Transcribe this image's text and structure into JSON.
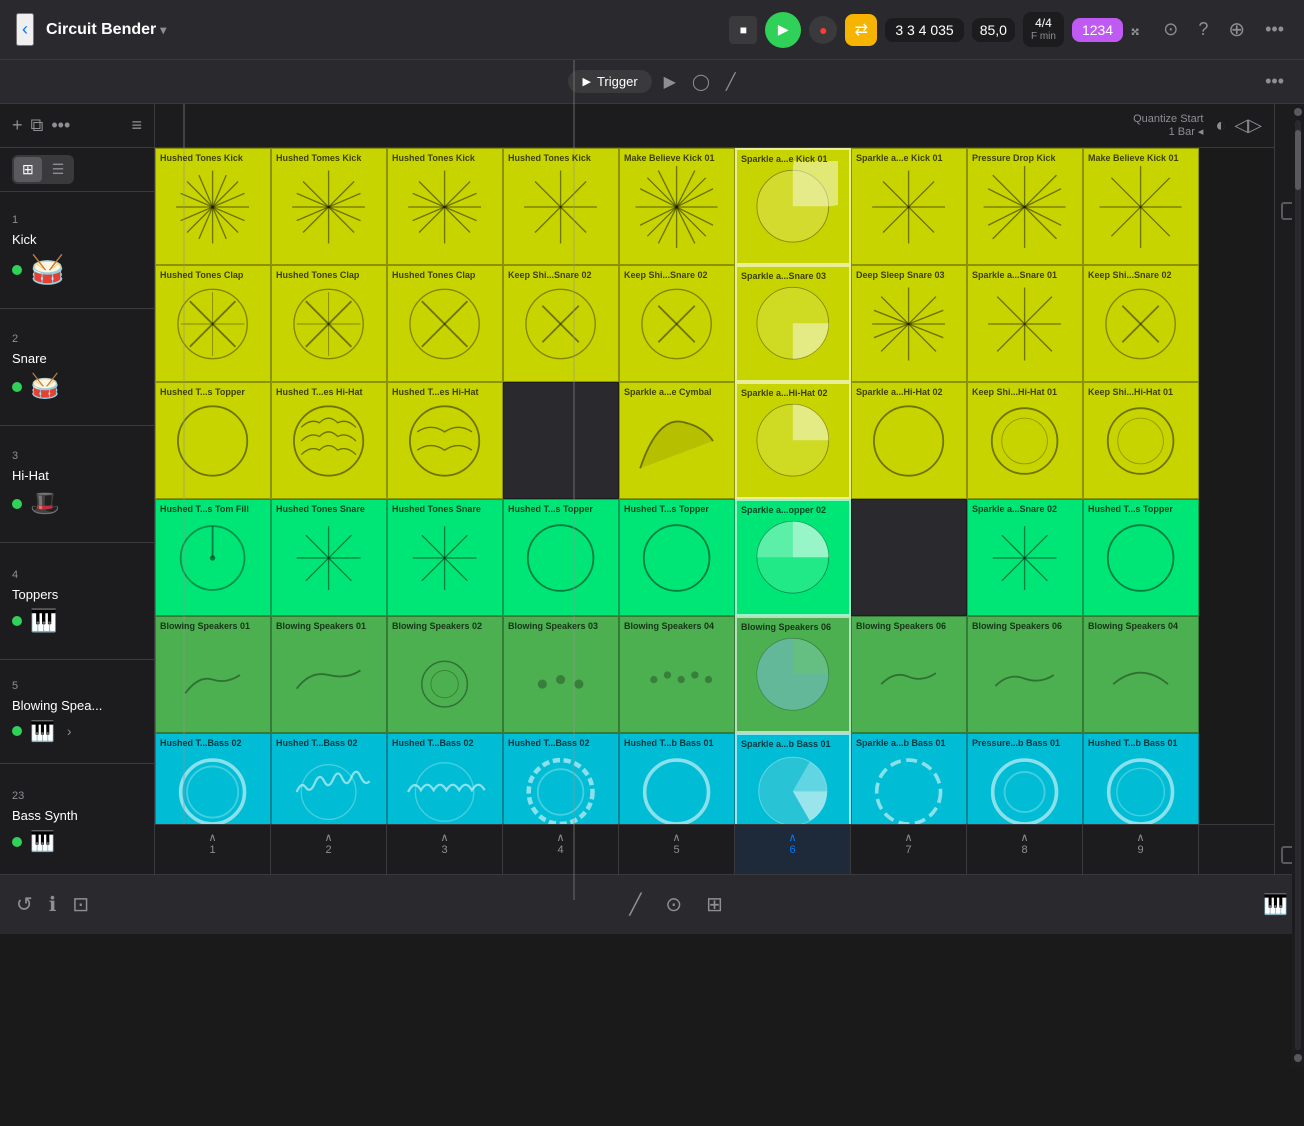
{
  "header": {
    "back": "‹",
    "project_name": "Circuit Bender",
    "chevron": "▾",
    "stop_icon": "■",
    "play_icon": "▶",
    "record_icon": "●",
    "loop_icon": "⇄",
    "position": "3  3  4  035",
    "tempo": "85,0",
    "time_sig_top": "4/4",
    "time_sig_bottom": "F min",
    "key": "1234",
    "metronome_icon": "𝄪",
    "settings_icon": "⊙",
    "help_icon": "?",
    "add_icon": "⊕",
    "more_icon": "•••"
  },
  "second_bar": {
    "trigger_label": "Trigger",
    "trigger_play_icon": "▶",
    "loop_icon": "◯",
    "edit_icon": "╱"
  },
  "sidebar_header": {
    "add_label": "+",
    "duplicate_icon": "⧉",
    "more_icon": "•••",
    "arrange_icon": "≡↕",
    "grid_icon": "⊞",
    "list_icon": "☰"
  },
  "quantize": {
    "label": "Quantize Start",
    "value": "1 Bar ◂"
  },
  "tracks": [
    {
      "num": "1",
      "name": "Kick",
      "dot_color": "#30d158",
      "icon": "🥁"
    },
    {
      "num": "2",
      "name": "Snare",
      "dot_color": "#30d158",
      "icon": "🥁"
    },
    {
      "num": "3",
      "name": "Hi-Hat",
      "dot_color": "#30d158",
      "icon": "🎩"
    },
    {
      "num": "4",
      "name": "Toppers",
      "dot_color": "#30d158",
      "icon": "🎹"
    },
    {
      "num": "5",
      "name": "Blowing Spea...",
      "dot_color": "#30d158",
      "icon": "🎹"
    },
    {
      "num": "23",
      "name": "Bass Synth",
      "dot_color": "#30d158",
      "icon": "🎹"
    }
  ],
  "columns": [
    {
      "num": "1",
      "active": false
    },
    {
      "num": "2",
      "active": false
    },
    {
      "num": "3",
      "active": false
    },
    {
      "num": "4",
      "active": false
    },
    {
      "num": "5",
      "active": false
    },
    {
      "num": "6",
      "active": true
    },
    {
      "num": "7",
      "active": false
    },
    {
      "num": "8",
      "active": false
    },
    {
      "num": "9",
      "active": false
    }
  ],
  "cells": {
    "row0": [
      {
        "label": "Hushed Tones Kick",
        "color": "yellow-green",
        "type": "burst"
      },
      {
        "label": "Hushed Tomes Kick",
        "color": "yellow-green",
        "type": "burst"
      },
      {
        "label": "Hushed Tones Kick",
        "color": "yellow-green",
        "type": "burst"
      },
      {
        "label": "Hushed Tones Kick",
        "color": "yellow-green",
        "type": "burst"
      },
      {
        "label": "Make Believe Kick 01",
        "color": "yellow-green",
        "type": "burst2"
      },
      {
        "label": "Sparkle a...e Kick 01",
        "color": "yellow-green",
        "type": "pie"
      },
      {
        "label": "Sparkle a...e Kick 01",
        "color": "yellow-green",
        "type": "burst"
      },
      {
        "label": "Pressure Drop Kick",
        "color": "yellow-green",
        "type": "burst"
      },
      {
        "label": "Make Believe Kick 01",
        "color": "yellow-green",
        "type": "burst"
      }
    ],
    "row1": [
      {
        "label": "Hushed Tones Clap",
        "color": "yellow-green",
        "type": "x"
      },
      {
        "label": "Hushed Tones Clap",
        "color": "yellow-green",
        "type": "x"
      },
      {
        "label": "Hushed Tones Clap",
        "color": "yellow-green",
        "type": "x"
      },
      {
        "label": "Keep Shi...Snare 02",
        "color": "yellow-green",
        "type": "circle-x"
      },
      {
        "label": "Keep Shi...Snare 02",
        "color": "yellow-green",
        "type": "circle-x"
      },
      {
        "label": "Sparkle a...Snare 03",
        "color": "yellow-green",
        "type": "pie"
      },
      {
        "label": "Deep Sleep Snare 03",
        "color": "yellow-green",
        "type": "star"
      },
      {
        "label": "Sparkle a...Snare 01",
        "color": "yellow-green",
        "type": "star"
      },
      {
        "label": "Keep Shi...Snare 02",
        "color": "yellow-green",
        "type": "circle-x"
      }
    ],
    "row2": [
      {
        "label": "Hushed T...s Topper",
        "color": "yellow-green",
        "type": "circle"
      },
      {
        "label": "Hushed T...es Hi-Hat",
        "color": "yellow-green",
        "type": "circle-wave"
      },
      {
        "label": "Hushed T...es Hi-Hat",
        "color": "yellow-green",
        "type": "circle-wave"
      },
      {
        "label": "",
        "color": "empty",
        "type": "empty"
      },
      {
        "label": "Sparkle a...e Cymbal",
        "color": "yellow-green",
        "type": "horn"
      },
      {
        "label": "Sparkle a...Hi-Hat 02",
        "color": "yellow-green",
        "type": "pie"
      },
      {
        "label": "Sparkle a...Hi-Hat 02",
        "color": "yellow-green",
        "type": "circle"
      },
      {
        "label": "Keep Shi...Hi-Hat 01",
        "color": "yellow-green",
        "type": "circle"
      },
      {
        "label": "Keep Shi...Hi-Hat 01",
        "color": "yellow-green",
        "type": "circle"
      }
    ],
    "row3": [
      {
        "label": "Hushed T...s Tom Fill",
        "color": "bright-green",
        "type": "dial"
      },
      {
        "label": "Hushed Tones Snare",
        "color": "bright-green",
        "type": "burst-sm"
      },
      {
        "label": "Hushed Tones Snare",
        "color": "bright-green",
        "type": "burst-sm"
      },
      {
        "label": "Hushed T...s Topper",
        "color": "bright-green",
        "type": "circle"
      },
      {
        "label": "Hushed T...s Topper",
        "color": "bright-green",
        "type": "circle"
      },
      {
        "label": "Sparkle a...opper 02",
        "color": "bright-green",
        "type": "pie"
      },
      {
        "label": "",
        "color": "empty",
        "type": "empty"
      },
      {
        "label": "Sparkle a...Snare 02",
        "color": "bright-green",
        "type": "burst-sm"
      },
      {
        "label": "Hushed T...s Topper",
        "color": "bright-green",
        "type": "circle"
      }
    ],
    "row4": [
      {
        "label": "Blowing Speakers 01",
        "color": "mid-green",
        "type": "arc"
      },
      {
        "label": "Blowing Speakers 01",
        "color": "mid-green",
        "type": "arc"
      },
      {
        "label": "Blowing Speakers 02",
        "color": "mid-green",
        "type": "arc"
      },
      {
        "label": "Blowing Speakers 03",
        "color": "mid-green",
        "type": "dots"
      },
      {
        "label": "Blowing Speakers 04",
        "color": "mid-green",
        "type": "dots"
      },
      {
        "label": "Blowing Speakers 06",
        "color": "mid-green",
        "type": "pie-lg"
      },
      {
        "label": "Blowing Speakers 06",
        "color": "mid-green",
        "type": "arc"
      },
      {
        "label": "Blowing Speakers 06",
        "color": "mid-green",
        "type": "arc"
      },
      {
        "label": "Blowing Speakers 04",
        "color": "mid-green",
        "type": "arc"
      }
    ],
    "row5": [
      {
        "label": "Hushed T...Bass 02",
        "color": "teal",
        "type": "ring"
      },
      {
        "label": "Hushed T...Bass 02",
        "color": "teal",
        "type": "ring-wave"
      },
      {
        "label": "Hushed T...Bass 02",
        "color": "teal",
        "type": "ring-wave"
      },
      {
        "label": "Hushed T...Bass 02",
        "color": "teal",
        "type": "ring-wave"
      },
      {
        "label": "Hushed T...b Bass 01",
        "color": "teal",
        "type": "ring"
      },
      {
        "label": "Sparkle a...b Bass 01",
        "color": "teal",
        "type": "pie-ring"
      },
      {
        "label": "Sparkle a...b Bass 01",
        "color": "teal",
        "type": "ring-spin"
      },
      {
        "label": "Pressure...b Bass 01",
        "color": "teal",
        "type": "ring"
      },
      {
        "label": "Hushed T...b Bass 01",
        "color": "teal",
        "type": "ring"
      }
    ]
  },
  "bottom_bar": {
    "help_icon": "ℹ",
    "info_icon": "ⓘ",
    "layout_icon": "⊡",
    "edit_icon": "╱",
    "clock_icon": "⊙",
    "mix_icon": "⊞",
    "piano_icon": "🎹"
  }
}
